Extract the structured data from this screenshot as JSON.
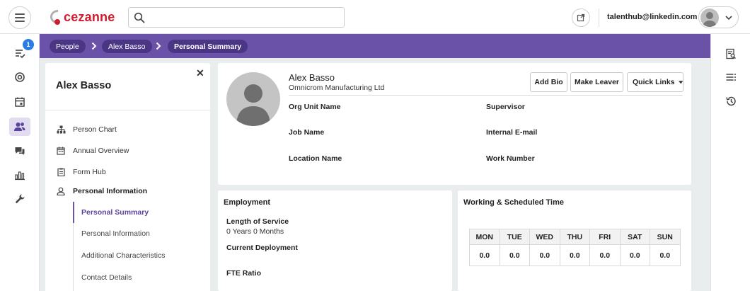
{
  "app": {
    "brand": "cezanne",
    "brand_color": "#d11a2e",
    "accent": "#6a52a8"
  },
  "header": {
    "search": {
      "placeholder": "",
      "value": ""
    },
    "user_email": "talenthub@linkedin.com"
  },
  "rail": {
    "items": [
      {
        "icon": "tasks-icon",
        "badge": "1"
      },
      {
        "icon": "target-icon"
      },
      {
        "icon": "calendar-icon"
      },
      {
        "icon": "people-icon",
        "active": true
      },
      {
        "icon": "chat-icon"
      },
      {
        "icon": "bar-chart-icon"
      },
      {
        "icon": "wrench-icon"
      }
    ]
  },
  "right_rail": {
    "items": [
      "report-search-icon",
      "list-icon",
      "history-icon"
    ]
  },
  "breadcrumb": [
    "People",
    "Alex Basso",
    "Personal Summary"
  ],
  "nav": {
    "person_name": "Alex Basso",
    "items": [
      {
        "label": "Person Chart",
        "icon": "org-chart-icon"
      },
      {
        "label": "Annual Overview",
        "icon": "calendar-icon"
      },
      {
        "label": "Form Hub",
        "icon": "clipboard-icon"
      },
      {
        "label": "Personal Information",
        "icon": "user-icon"
      }
    ],
    "sub_items": [
      {
        "label": "Personal Summary",
        "active": true
      },
      {
        "label": "Personal Information"
      },
      {
        "label": "Additional Characteristics"
      },
      {
        "label": "Contact Details"
      }
    ]
  },
  "summary": {
    "name": "Alex Basso",
    "company": "Omnicrom Manufacturing Ltd",
    "buttons": {
      "add_bio": "Add Bio",
      "make_leaver": "Make Leaver",
      "quick_links": "Quick Links"
    },
    "fields": {
      "org_unit": "Org Unit Name",
      "supervisor": "Supervisor",
      "job_name": "Job Name",
      "internal_email": "Internal E-mail",
      "location_name": "Location Name",
      "work_number": "Work Number"
    }
  },
  "employment": {
    "title": "Employment",
    "length_of_service_label": "Length of Service",
    "length_of_service_value": "0 Years 0 Months",
    "current_deployment_label": "Current Deployment",
    "fte_ratio_label": "FTE Ratio"
  },
  "working_time": {
    "title": "Working & Scheduled Time",
    "days": [
      "MON",
      "TUE",
      "WED",
      "THU",
      "FRI",
      "SAT",
      "SUN"
    ],
    "hours": [
      "0.0",
      "0.0",
      "0.0",
      "0.0",
      "0.0",
      "0.0",
      "0.0"
    ]
  }
}
